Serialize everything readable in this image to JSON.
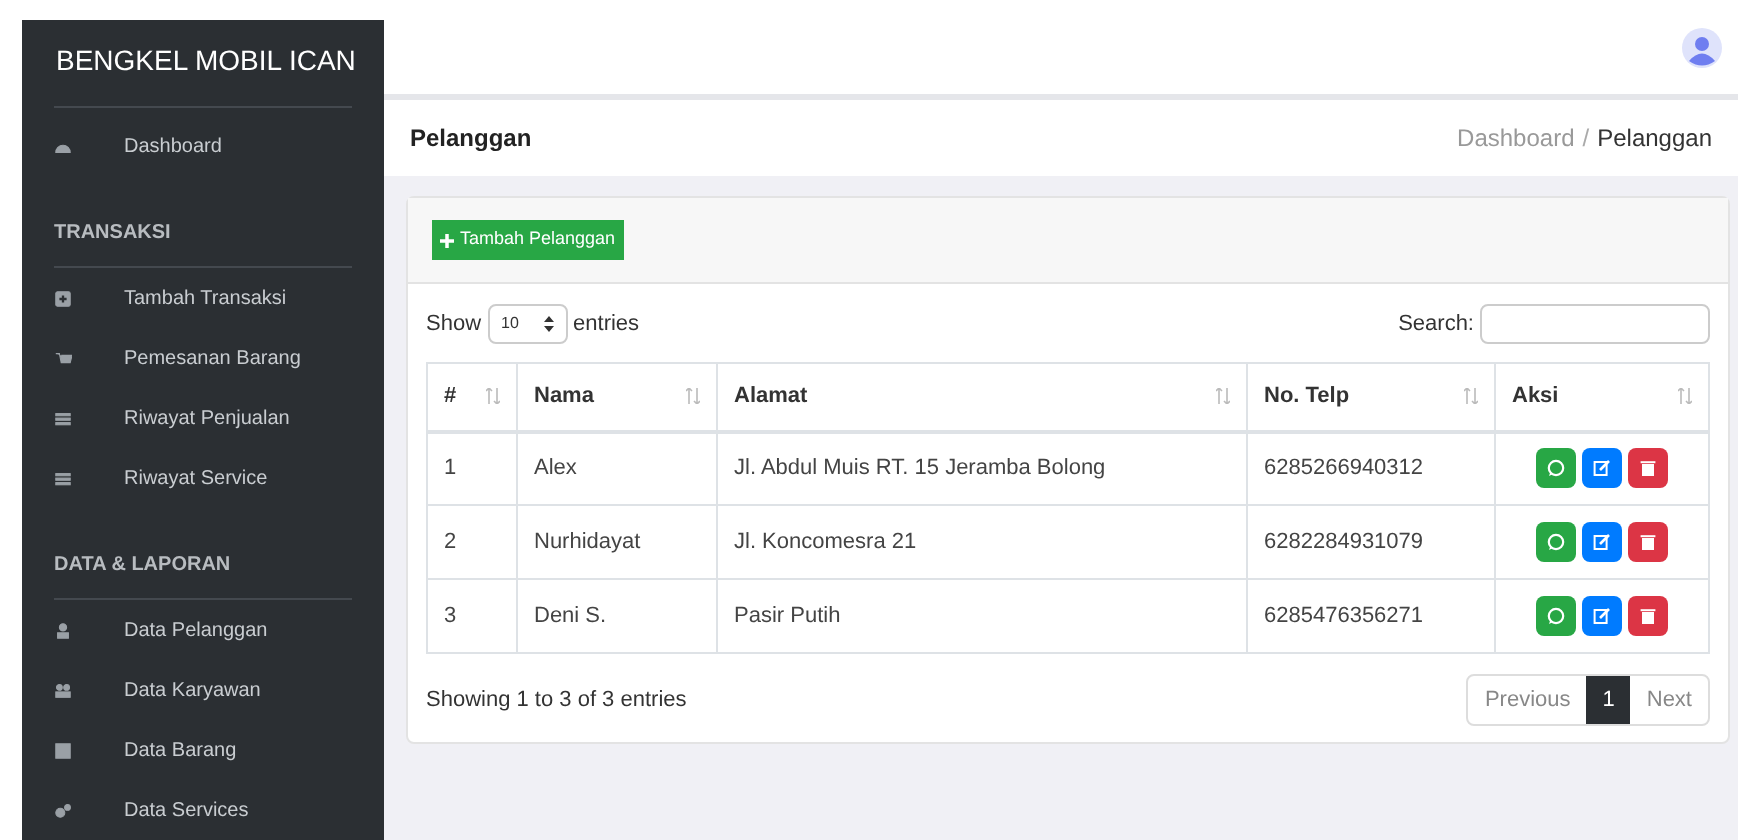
{
  "sidebar": {
    "brand": "BENGKEL MOBIL ICAN",
    "items": [
      {
        "kind": "link",
        "label": "Dashboard"
      },
      {
        "kind": "heading",
        "label": "TRANSAKSI"
      },
      {
        "kind": "link",
        "label": "Tambah Transaksi"
      },
      {
        "kind": "link",
        "label": "Pemesanan Barang"
      },
      {
        "kind": "link",
        "label": "Riwayat Penjualan"
      },
      {
        "kind": "link",
        "label": "Riwayat Service"
      },
      {
        "kind": "heading",
        "label": "DATA & LAPORAN"
      },
      {
        "kind": "link",
        "label": "Data Pelanggan"
      },
      {
        "kind": "link",
        "label": "Data Karyawan"
      },
      {
        "kind": "link",
        "label": "Data Barang"
      },
      {
        "kind": "link",
        "label": "Data Services"
      }
    ]
  },
  "page_title": "Pelanggan",
  "breadcrumb": [
    {
      "label": "Dashboard",
      "selected": false
    },
    {
      "label": "Pelanggan",
      "selected": true
    }
  ],
  "breadcrumb_separator": "/",
  "add_button": "Tambah Pelanggan",
  "length": {
    "label_before": "Show",
    "value": "10",
    "label_after": "entries"
  },
  "search": {
    "label": "Search:"
  },
  "table": {
    "columns": [
      "#",
      "Nama",
      "Alamat",
      "No. Telp",
      "Aksi"
    ],
    "rows": [
      {
        "cells": [
          "1",
          "Alex",
          "Jl. Abdul Muis RT. 15 Jeramba Bolong",
          "6285266940312"
        ]
      },
      {
        "cells": [
          "2",
          "Nurhidayat",
          "Jl. Koncomesra 21",
          "6282284931079"
        ]
      },
      {
        "cells": [
          "3",
          "Deni S.",
          "Pasir Putih",
          "6285476356271"
        ]
      }
    ]
  },
  "info": "Showing 1 to 3 of 3 entries",
  "pagination": [
    {
      "label": "Previous",
      "selected": false
    },
    {
      "label": "1",
      "selected": true
    },
    {
      "label": "Next",
      "selected": false
    }
  ]
}
